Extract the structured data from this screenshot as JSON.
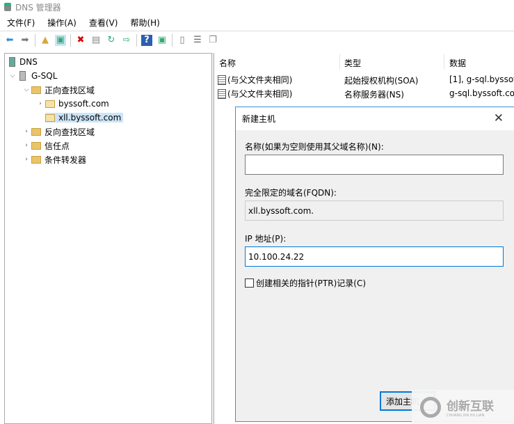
{
  "window": {
    "title": "DNS 管理器"
  },
  "menu": [
    "文件(F)",
    "操作(A)",
    "查看(V)",
    "帮助(H)"
  ],
  "toolbar": [
    "back-arrow-icon",
    "forward-arrow-icon",
    "up-folder-icon",
    "show-tree-icon",
    "delete-icon",
    "properties-icon",
    "refresh-icon",
    "export-icon",
    "help-icon",
    "action-pane-icon",
    "server-icon",
    "list-icon",
    "copy-icon"
  ],
  "tree": {
    "root": "DNS",
    "server": "G-SQL",
    "forward": "正向查找区域",
    "zones": [
      "byssoft.com",
      "xll.byssoft.com"
    ],
    "reverse": "反向查找区域",
    "trust": "信任点",
    "forwarders": "条件转发器"
  },
  "list": {
    "headers": [
      "名称",
      "类型",
      "数据"
    ],
    "rows": [
      {
        "name": "(与父文件夹相同)",
        "type": "起始授权机构(SOA)",
        "data": "[1], g-sql.byssof"
      },
      {
        "name": "(与父文件夹相同)",
        "type": "名称服务器(NS)",
        "data": "g-sql.byssoft.co"
      }
    ]
  },
  "dialog": {
    "title": "新建主机",
    "name_label": "名称(如果为空则使用其父域名称)(N):",
    "name_value": "",
    "fqdn_label": "完全限定的域名(FQDN):",
    "fqdn_value": "xll.byssoft.com.",
    "ip_label": "IP 地址(P):",
    "ip_value": "10.100.24.22",
    "ptr_label": "创建相关的指针(PTR)记录(C)",
    "ptr_checked": false,
    "add_button": "添加主机"
  },
  "watermark": {
    "text": "创新互联",
    "sub": "CHUANG XIN HU LIAN"
  }
}
